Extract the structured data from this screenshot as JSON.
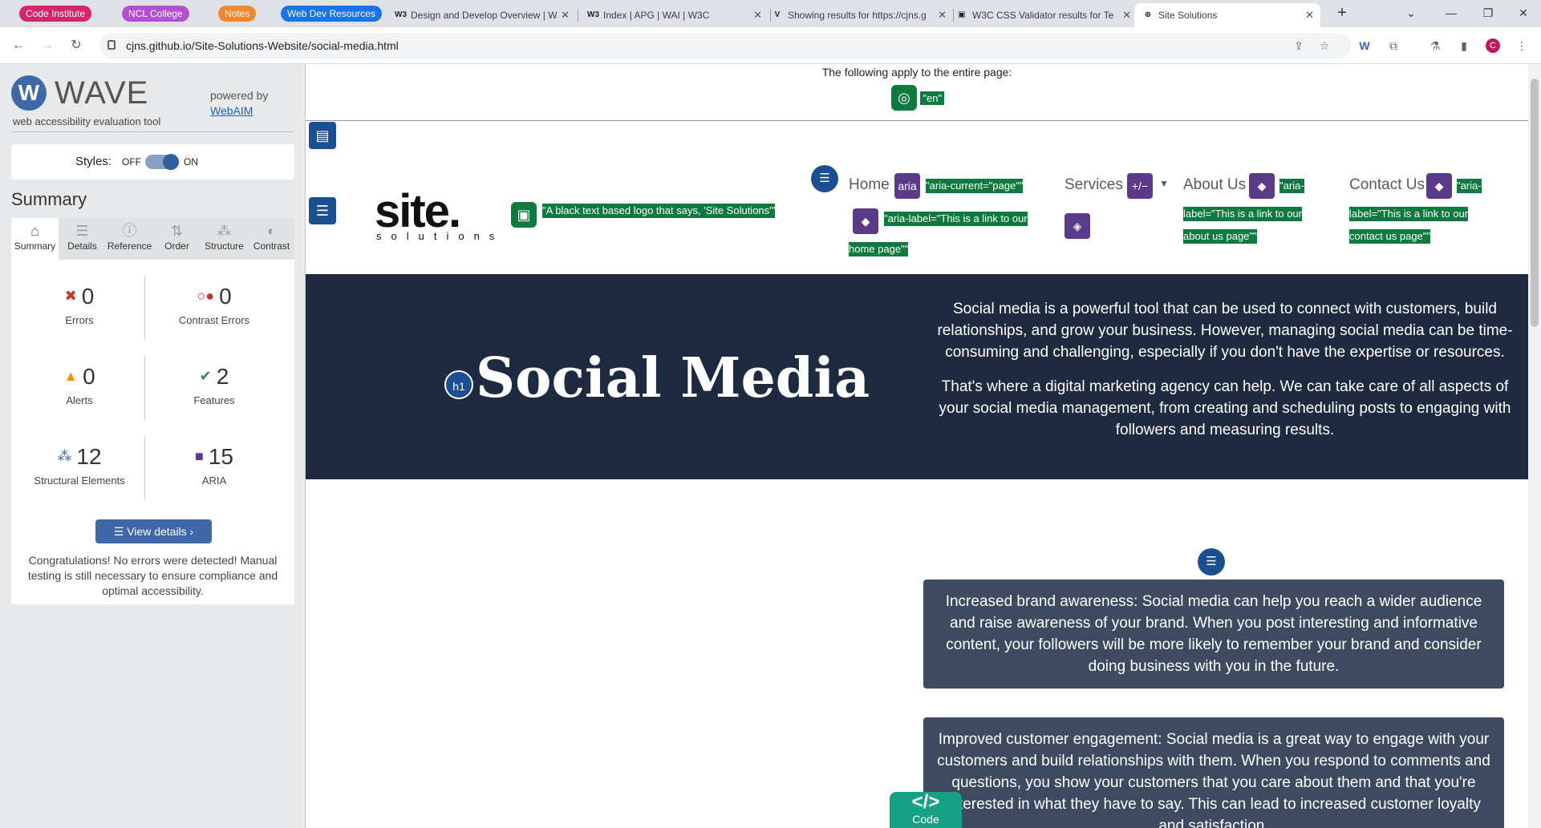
{
  "browser": {
    "bookmarks": [
      {
        "label": "Code Institute",
        "color": "#d6246e"
      },
      {
        "label": "NCL College",
        "color": "#b34fd1"
      },
      {
        "label": "Notes",
        "color": "#f0882f"
      },
      {
        "label": "Web Dev Resources",
        "color": "#1a73e8"
      }
    ],
    "tabs": [
      {
        "icon": "W3",
        "title": "Design and Develop Overview | W"
      },
      {
        "icon": "W3",
        "title": "Index | APG | WAI | W3C"
      },
      {
        "icon": "V",
        "title": "Showing results for https://cjns.g"
      },
      {
        "icon": "▣",
        "title": "W3C CSS Validator results for Te"
      },
      {
        "icon": "⊕",
        "title": "Site Solutions"
      }
    ],
    "url": "cjns.github.io/Site-Solutions-Website/social-media.html",
    "profile_letter": "C"
  },
  "wave": {
    "title": "WAVE",
    "subtitle": "web accessibility evaluation tool",
    "powered_by": "powered by",
    "webaim": "WebAIM",
    "styles_label": "Styles:",
    "off": "OFF",
    "on": "ON",
    "summary_heading": "Summary",
    "tabs": [
      "Summary",
      "Details",
      "Reference",
      "Order",
      "Structure",
      "Contrast"
    ],
    "stats": [
      {
        "value": "0",
        "label": "Errors",
        "icon": "error-icon",
        "color": "#c0392b"
      },
      {
        "value": "0",
        "label": "Contrast Errors",
        "icon": "contrast-error-icon",
        "color": "#c0392b"
      },
      {
        "value": "0",
        "label": "Alerts",
        "icon": "alert-icon",
        "color": "#e69a13"
      },
      {
        "value": "2",
        "label": "Features",
        "icon": "feature-icon",
        "color": "#2e8b57"
      },
      {
        "value": "12",
        "label": "Structural Elements",
        "icon": "structure-icon",
        "color": "#3e68a8"
      },
      {
        "value": "15",
        "label": "ARIA",
        "icon": "aria-icon",
        "color": "#5b3a8a"
      }
    ],
    "view_details": "View details ›",
    "congrats": "Congratulations! No errors were detected! Manual testing is still necessary to ensure compliance and optimal accessibility."
  },
  "page": {
    "apply_text": "The following apply to the entire page:",
    "lang_tag": "\"en\"",
    "logo_text": "site.",
    "logo_sub": "solutions",
    "logo_alt_tag": "\"A black text based logo that says, 'Site Solutions'\"",
    "nav": {
      "home": "Home",
      "services": "Services",
      "about": "About Us",
      "contact": "Contact Us",
      "aria_icon": "aria",
      "aria_current": "\"aria-current=\"page\"\"",
      "home_label_tag_1": "\"aria-label=\"This is a link to our",
      "home_label_tag_2": "home page\"\"",
      "about_tag_1": "\"aria-",
      "about_tag_2": "label=\"This is a link to our",
      "about_tag_3": "about us page\"\"",
      "contact_tag_1": "\"aria-",
      "contact_tag_2": "label=\"This is a link to our",
      "contact_tag_3": "contact us page\"\"",
      "plusminus": "+/−"
    },
    "hero": {
      "h1_icon": "h1",
      "title": "Social Media",
      "p1": "Social media is a powerful tool that can be used to connect with customers, build relationships, and grow your business. However, managing social media can be time-consuming and challenging, especially if you don't have the expertise or resources.",
      "p2": "That's where a digital marketing agency can help. We can take care of all aspects of your social media management, from creating and scheduling posts to engaging with followers and measuring results."
    },
    "cards": [
      "Increased brand awareness: Social media can help you reach a wider audience and raise awareness of your brand. When you post interesting and informative content, your followers will be more likely to remember your brand and consider doing business with you in the future.",
      "Improved customer engagement: Social media is a great way to engage with your customers and build relationships with them. When you respond to comments and questions, you show your customers that you care about them and that you're interested in what they have to say. This can lead to increased customer loyalty and satisfaction."
    ],
    "code_button": {
      "glyph": "</>",
      "label": "Code"
    }
  }
}
